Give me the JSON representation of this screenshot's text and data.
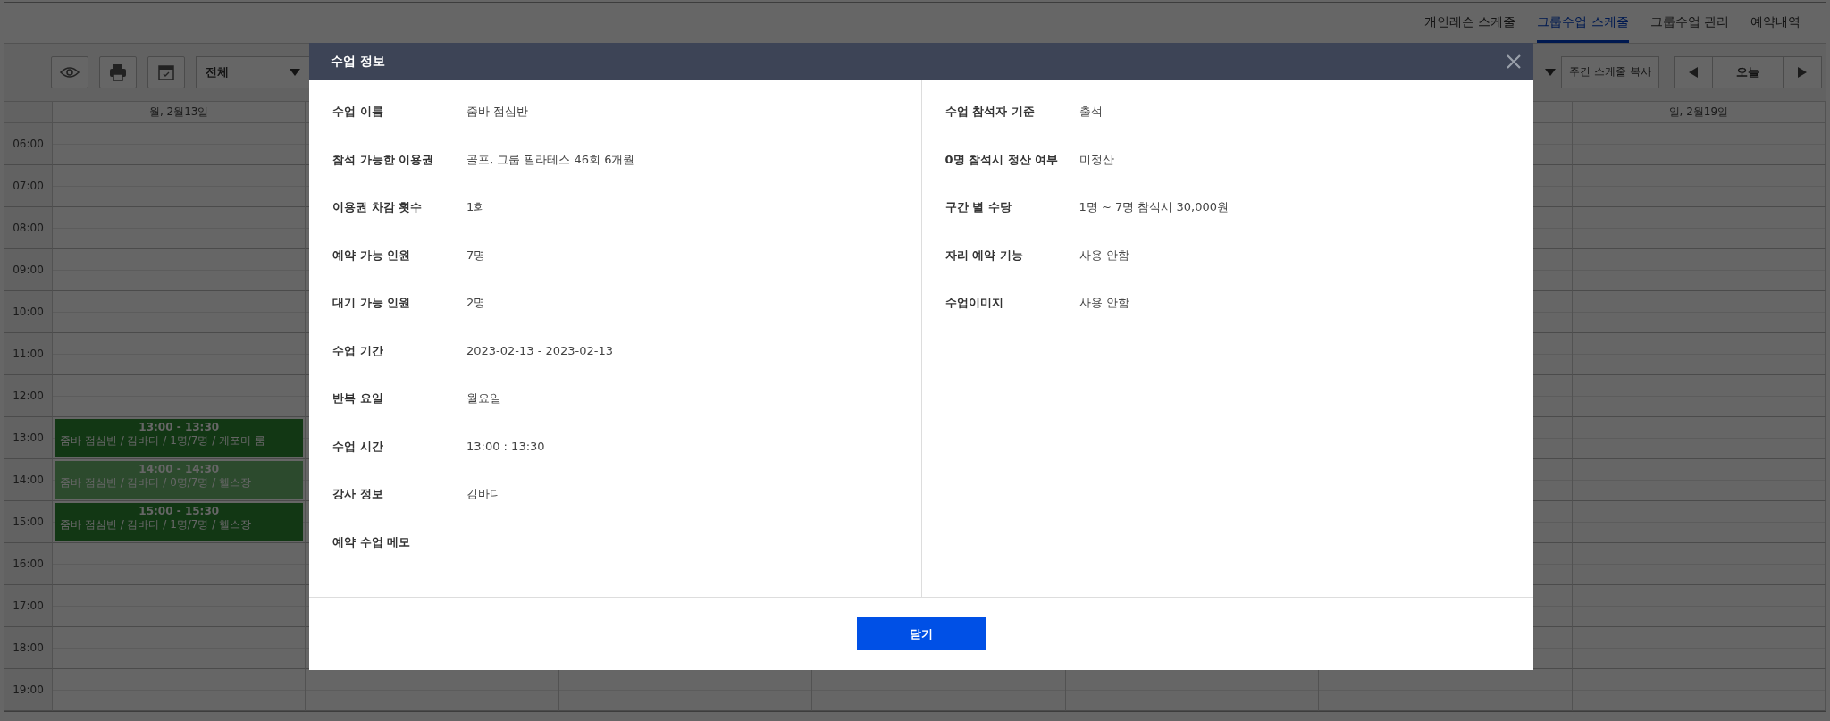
{
  "nav_tabs": [
    {
      "label": "개인레슨 스케줄",
      "selected": false
    },
    {
      "label": "그룹수업 스케줄",
      "selected": true
    },
    {
      "label": "그룹수업 관리",
      "selected": false
    },
    {
      "label": "예약내역",
      "selected": false
    }
  ],
  "toolbar": {
    "filter_select": {
      "value": "전체"
    },
    "copy_button": "주간 스케줄 복사",
    "today_button": "오늘"
  },
  "calendar": {
    "day_headers": [
      "월, 2월13일",
      "일, 2월19일"
    ],
    "rows": [
      {
        "time": "06:00"
      },
      {
        "time": "07:00"
      },
      {
        "time": "08:00"
      },
      {
        "time": "09:00"
      },
      {
        "time": "10:00"
      },
      {
        "time": "11:00"
      },
      {
        "time": "12:00"
      },
      {
        "time": "13:00",
        "events": [
          {
            "time": "13:00 - 13:30",
            "details": "줌바 점심반 / 김바디 / 1명/7명 / 케포머 룸",
            "dimmed": false
          }
        ]
      },
      {
        "time": "14:00",
        "events": [
          {
            "time": "14:00 - 14:30",
            "details": "줌바 점심반 / 김바디 / 0명/7명 / 헬스장",
            "dimmed": true
          }
        ]
      },
      {
        "time": "15:00",
        "events": [
          {
            "time": "15:00 - 15:30",
            "details": "줌바 점심반 / 김바디 / 1명/7명 / 헬스장",
            "dimmed": false
          }
        ]
      },
      {
        "time": "16:00"
      },
      {
        "time": "17:00"
      },
      {
        "time": "18:00"
      },
      {
        "time": "19:00"
      }
    ]
  },
  "modal": {
    "title": "수업 정보",
    "left_fields": [
      {
        "label": "수업 이름",
        "value": "줌바 점심반"
      },
      {
        "label": "참석 가능한 이용권",
        "value": "골프, 그룹 필라테스 46회 6개월"
      },
      {
        "label": "이용권 차감 횟수",
        "value": "1회"
      },
      {
        "label": "예약 가능 인원",
        "value": "7명"
      },
      {
        "label": "대기 가능 인원",
        "value": "2명"
      },
      {
        "label": "수업 기간",
        "value": "2023-02-13 - 2023-02-13"
      },
      {
        "label": "반복 요일",
        "value": "월요일"
      },
      {
        "label": "수업 시간",
        "value": "13:00 : 13:30"
      },
      {
        "label": "강사 정보",
        "value": "김바디"
      },
      {
        "label": "예약 수업 메모"
      }
    ],
    "right_fields": [
      {
        "label": "수업 참석자 기준",
        "value": "출석"
      },
      {
        "label": "0명 참석시 정산 여부",
        "value": "미정산"
      },
      {
        "label": "구간 별 수당",
        "value": "1명 ~ 7명 참석시 30,000원"
      },
      {
        "label": "자리 예약 기능",
        "value": "사용 안함"
      },
      {
        "label": "수업이미지",
        "value": "사용 안함"
      }
    ],
    "close_button": "닫기"
  }
}
